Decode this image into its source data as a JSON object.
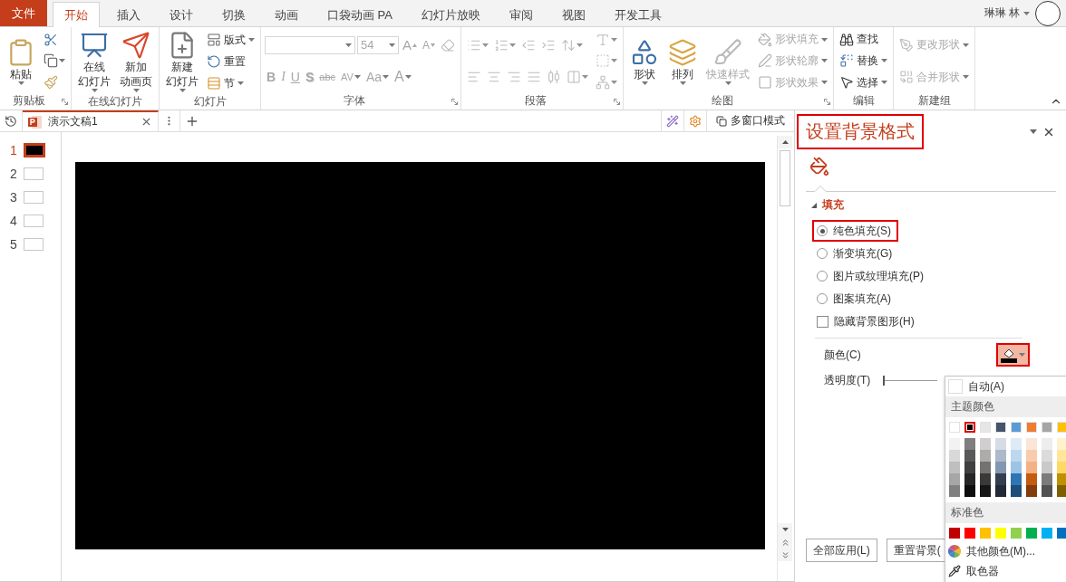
{
  "ribbon_tabs": [
    {
      "label": "文件",
      "kind": "file",
      "selected": false
    },
    {
      "label": "开始",
      "kind": "tab",
      "selected": true
    },
    {
      "label": "插入",
      "kind": "tab",
      "selected": false
    },
    {
      "label": "设计",
      "kind": "tab",
      "selected": false
    },
    {
      "label": "切换",
      "kind": "tab",
      "selected": false
    },
    {
      "label": "动画",
      "kind": "tab",
      "selected": false
    },
    {
      "label": "口袋动画 PA",
      "kind": "tab",
      "selected": false
    },
    {
      "label": "幻灯片放映",
      "kind": "tab",
      "selected": false
    },
    {
      "label": "审阅",
      "kind": "tab",
      "selected": false
    },
    {
      "label": "视图",
      "kind": "tab",
      "selected": false
    },
    {
      "label": "开发工具",
      "kind": "tab",
      "selected": false
    }
  ],
  "user": {
    "name": "琳琳 林"
  },
  "ribbon_groups": [
    {
      "label": "剪贴板",
      "launcher": true,
      "columns": [
        [
          [
            {
              "kind": "large",
              "lines": [
                "粘贴"
              ],
              "dropdown": true,
              "disabled": false
            }
          ]
        ],
        [
          [
            {
              "kind": "icon",
              "dropdown": false,
              "disabled": false
            }
          ],
          [
            {
              "kind": "icon",
              "dropdown": true,
              "disabled": false
            }
          ],
          [
            {
              "kind": "icon",
              "dropdown": false,
              "disabled": false
            }
          ]
        ]
      ]
    },
    {
      "label": "在线幻灯片",
      "launcher": false,
      "columns": [
        [
          [
            {
              "kind": "large",
              "lines": [
                "在线",
                "幻灯片"
              ],
              "dropdown": true,
              "disabled": false
            }
          ]
        ],
        [
          [
            {
              "kind": "large",
              "lines": [
                "新加",
                "动画页"
              ],
              "dropdown": true,
              "disabled": false
            }
          ]
        ]
      ]
    },
    {
      "label": "幻灯片",
      "launcher": false,
      "columns": [
        [
          [
            {
              "kind": "large",
              "lines": [
                "新建",
                "幻灯片"
              ],
              "dropdown": true,
              "disabled": false
            }
          ]
        ],
        [
          [
            {
              "kind": "small",
              "label": "版式",
              "dropdown": true,
              "disabled": false
            }
          ],
          [
            {
              "kind": "small",
              "label": "重置",
              "dropdown": false,
              "disabled": false
            }
          ],
          [
            {
              "kind": "small",
              "label": "节",
              "dropdown": true,
              "disabled": false
            }
          ]
        ]
      ]
    },
    {
      "label": "字体",
      "launcher": true,
      "columns": [
        [
          [
            {
              "kind": "font-field",
              "dropdown": true,
              "disabled": true
            },
            {
              "kind": "size-field",
              "value": "54",
              "dropdown": true,
              "disabled": true
            },
            {
              "kind": "glyph",
              "glyph": "A",
              "dropdown": false,
              "disabled": true
            },
            {
              "kind": "glyph",
              "glyph": "A",
              "dropdown": false,
              "disabled": true
            },
            {
              "kind": "icon",
              "dropdown": false,
              "disabled": true
            }
          ],
          [
            {
              "kind": "glyph",
              "glyph": "B",
              "dropdown": false,
              "disabled": true
            },
            {
              "kind": "glyph",
              "glyph": "I",
              "dropdown": false,
              "disabled": true
            },
            {
              "kind": "glyph",
              "glyph": "U",
              "dropdown": false,
              "disabled": true
            },
            {
              "kind": "glyph",
              "glyph": "S",
              "dropdown": false,
              "disabled": true
            },
            {
              "kind": "glyph",
              "glyph": "abc",
              "dropdown": false,
              "disabled": true
            },
            {
              "kind": "glyph",
              "glyph": "AV",
              "dropdown": true,
              "disabled": true
            },
            {
              "kind": "glyph",
              "glyph": "Aa",
              "dropdown": true,
              "disabled": true
            },
            {
              "kind": "glyph",
              "glyph": "A",
              "dropdown": true,
              "disabled": true
            }
          ]
        ]
      ]
    },
    {
      "label": "段落",
      "launcher": true,
      "columns": [
        [
          [
            {
              "kind": "icon",
              "dropdown": true,
              "disabled": true
            },
            {
              "kind": "icon",
              "dropdown": true,
              "disabled": true
            },
            {
              "kind": "icon",
              "dropdown": false,
              "disabled": true
            },
            {
              "kind": "icon",
              "dropdown": false,
              "disabled": true
            },
            {
              "kind": "icon",
              "dropdown": true,
              "disabled": true
            }
          ],
          [
            {
              "kind": "icon",
              "dropdown": false,
              "disabled": true
            },
            {
              "kind": "icon",
              "dropdown": false,
              "disabled": true
            },
            {
              "kind": "icon",
              "dropdown": false,
              "disabled": true
            },
            {
              "kind": "icon",
              "dropdown": false,
              "disabled": true
            },
            {
              "kind": "icon",
              "dropdown": false,
              "disabled": true
            },
            {
              "kind": "icon",
              "dropdown": true,
              "disabled": true
            }
          ]
        ],
        [
          [
            {
              "kind": "icon",
              "dropdown": true,
              "disabled": true
            }
          ],
          [
            {
              "kind": "icon",
              "dropdown": true,
              "disabled": true
            }
          ],
          [
            {
              "kind": "icon",
              "dropdown": true,
              "disabled": true
            }
          ]
        ]
      ]
    },
    {
      "label": "绘图",
      "launcher": true,
      "columns": [
        [
          [
            {
              "kind": "large",
              "lines": [
                "形状"
              ],
              "dropdown": true,
              "disabled": false
            }
          ]
        ],
        [
          [
            {
              "kind": "large",
              "lines": [
                "排列"
              ],
              "dropdown": true,
              "disabled": false
            }
          ]
        ],
        [
          [
            {
              "kind": "large",
              "lines": [
                "快速样式"
              ],
              "dropdown": true,
              "disabled": true
            }
          ]
        ],
        [
          [
            {
              "kind": "small",
              "label": "形状填充",
              "dropdown": true,
              "disabled": true
            }
          ],
          [
            {
              "kind": "small",
              "label": "形状轮廓",
              "dropdown": true,
              "disabled": true
            }
          ],
          [
            {
              "kind": "small",
              "label": "形状效果",
              "dropdown": true,
              "disabled": true
            }
          ]
        ]
      ]
    },
    {
      "label": "编辑",
      "launcher": false,
      "columns": [
        [
          [
            {
              "kind": "small",
              "label": "查找",
              "dropdown": false,
              "disabled": false
            }
          ],
          [
            {
              "kind": "small",
              "label": "替换",
              "dropdown": true,
              "disabled": false
            }
          ],
          [
            {
              "kind": "small",
              "label": "选择",
              "dropdown": true,
              "disabled": false
            }
          ]
        ]
      ]
    },
    {
      "label": "新建组",
      "launcher": false,
      "columns": [
        [
          [
            {
              "kind": "small",
              "label": "更改形状",
              "dropdown": true,
              "disabled": true
            }
          ],
          [
            {
              "kind": "small",
              "label": "合并形状",
              "dropdown": true,
              "disabled": true
            }
          ]
        ]
      ]
    }
  ],
  "document_tabs": [
    {
      "title": "演示文稿1",
      "selected": true
    }
  ],
  "window_mode_button": "多窗口模式",
  "slides": [
    {
      "number": "1",
      "selected": true,
      "color": "#000000"
    },
    {
      "number": "2",
      "selected": false,
      "color": "#ffffff"
    },
    {
      "number": "3",
      "selected": false,
      "color": "#ffffff"
    },
    {
      "number": "4",
      "selected": false,
      "color": "#ffffff"
    },
    {
      "number": "5",
      "selected": false,
      "color": "#ffffff"
    }
  ],
  "slide": {
    "color": "#000000"
  },
  "format_pane": {
    "title": "设置背景格式",
    "title_highlighted": true,
    "section": {
      "label": "填充",
      "expanded": true
    },
    "options": [
      {
        "kind": "radio",
        "label": "纯色填充(S)",
        "selected": true,
        "highlighted": true
      },
      {
        "kind": "radio",
        "label": "渐变填充(G)",
        "selected": false,
        "highlighted": false
      },
      {
        "kind": "radio",
        "label": "图片或纹理填充(P)",
        "selected": false,
        "highlighted": false
      },
      {
        "kind": "radio",
        "label": "图案填充(A)",
        "selected": false,
        "highlighted": false
      },
      {
        "kind": "checkbox",
        "label": "隐藏背景图形(H)",
        "checked": false,
        "highlighted": false
      }
    ],
    "color_label": "颜色(C)",
    "color_button": {
      "color": "#000000",
      "highlighted": true
    },
    "transparency_label": "透明度(T)",
    "transparency": {
      "level": 0
    },
    "buttons": [
      "全部应用(L)",
      "重置背景("
    ]
  },
  "color_menu": {
    "auto_label": "自动(A)",
    "theme_header": "主题颜色",
    "theme_colors": [
      {
        "color": "#ffffff",
        "selected": false
      },
      {
        "color": "#000000",
        "selected": true
      },
      {
        "color": "#e7e6e6",
        "selected": false
      },
      {
        "color": "#44546a",
        "selected": false
      },
      {
        "color": "#5b9bd5",
        "selected": false
      },
      {
        "color": "#ed7d31",
        "selected": false
      },
      {
        "color": "#a5a5a5",
        "selected": false
      },
      {
        "color": "#ffc000",
        "selected": false
      }
    ],
    "shades": [
      [
        {
          "color": "#f2f2f2"
        },
        {
          "color": "#d9d9d9"
        },
        {
          "color": "#bfbfbf"
        },
        {
          "color": "#a6a6a6"
        },
        {
          "color": "#808080"
        }
      ],
      [
        {
          "color": "#7f7f7f"
        },
        {
          "color": "#595959"
        },
        {
          "color": "#404040"
        },
        {
          "color": "#262626"
        },
        {
          "color": "#0d0d0d"
        }
      ],
      [
        {
          "color": "#d0cece"
        },
        {
          "color": "#aeabab"
        },
        {
          "color": "#757171"
        },
        {
          "color": "#3a3838"
        },
        {
          "color": "#171616"
        }
      ],
      [
        {
          "color": "#d6dce5"
        },
        {
          "color": "#adb9ca"
        },
        {
          "color": "#8497b0"
        },
        {
          "color": "#333f50"
        },
        {
          "color": "#222a35"
        }
      ],
      [
        {
          "color": "#deebf7"
        },
        {
          "color": "#bdd7ee"
        },
        {
          "color": "#9dc3e6"
        },
        {
          "color": "#2e75b6"
        },
        {
          "color": "#1f4e79"
        }
      ],
      [
        {
          "color": "#fbe5d6"
        },
        {
          "color": "#f8cbad"
        },
        {
          "color": "#f4b183"
        },
        {
          "color": "#c55a11"
        },
        {
          "color": "#843c0c"
        }
      ],
      [
        {
          "color": "#ededed"
        },
        {
          "color": "#dbdbdb"
        },
        {
          "color": "#c9c9c9"
        },
        {
          "color": "#7b7b7b"
        },
        {
          "color": "#525252"
        }
      ],
      [
        {
          "color": "#fff2cc"
        },
        {
          "color": "#ffe699"
        },
        {
          "color": "#ffd966"
        },
        {
          "color": "#bf9000"
        },
        {
          "color": "#7f6000"
        }
      ]
    ],
    "standard_header": "标准色",
    "standard_colors": [
      {
        "color": "#c00000"
      },
      {
        "color": "#ff0000"
      },
      {
        "color": "#ffc000"
      },
      {
        "color": "#ffff00"
      },
      {
        "color": "#92d050"
      },
      {
        "color": "#00b050"
      },
      {
        "color": "#00b0f0"
      },
      {
        "color": "#0070c0"
      }
    ],
    "more_colors": "其他颜色(M)...",
    "eyedropper": "取色器"
  }
}
